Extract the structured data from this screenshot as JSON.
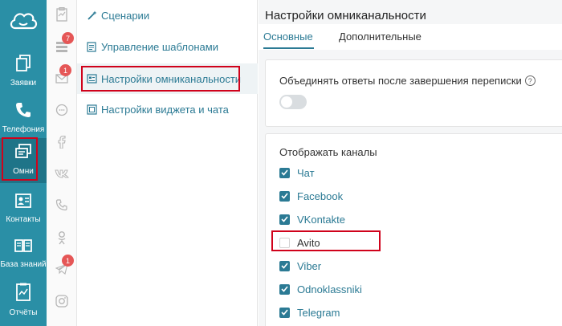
{
  "sidebar": {
    "items": [
      {
        "id": "requests",
        "label": "Заявки",
        "icon": "documents-icon"
      },
      {
        "id": "telephony",
        "label": "Телефония",
        "icon": "phone-icon"
      },
      {
        "id": "omni",
        "label": "Омни",
        "icon": "chat-windows-icon"
      },
      {
        "id": "contacts",
        "label": "Контакты",
        "icon": "contact-card-icon"
      },
      {
        "id": "knowledge",
        "label": "База знаний",
        "icon": "book-icon"
      },
      {
        "id": "reports",
        "label": "Отчёты",
        "icon": "report-icon"
      }
    ]
  },
  "channels": {
    "badges": {
      "templates": "7",
      "email": "1",
      "telegram": "1"
    }
  },
  "submenu": {
    "items": [
      {
        "label": "Сценарии",
        "icon": "wand-icon"
      },
      {
        "label": "Управление шаблонами",
        "icon": "template-icon"
      },
      {
        "label": "Настройки омниканальности",
        "icon": "settings-panel-icon"
      },
      {
        "label": "Настройки виджета и чата",
        "icon": "widget-icon"
      }
    ]
  },
  "main": {
    "title": "Настройки омниканальности",
    "tabs": [
      {
        "label": "Основные"
      },
      {
        "label": "Дополнительные"
      }
    ],
    "merge_label": "Объединять ответы после завершения переписки",
    "help_glyph": "?",
    "channels_title": "Отображать каналы",
    "channel_list": [
      {
        "label": "Чат",
        "checked": true
      },
      {
        "label": "Facebook",
        "checked": true
      },
      {
        "label": "VKontakte",
        "checked": true
      },
      {
        "label": "Avito",
        "checked": false
      },
      {
        "label": "Viber",
        "checked": true
      },
      {
        "label": "Odnoklassniki",
        "checked": true
      },
      {
        "label": "Telegram",
        "checked": true
      }
    ]
  },
  "colors": {
    "accent": "#2b7a94",
    "sidebar": "#2a8fa6",
    "highlight": "#d0021b"
  }
}
